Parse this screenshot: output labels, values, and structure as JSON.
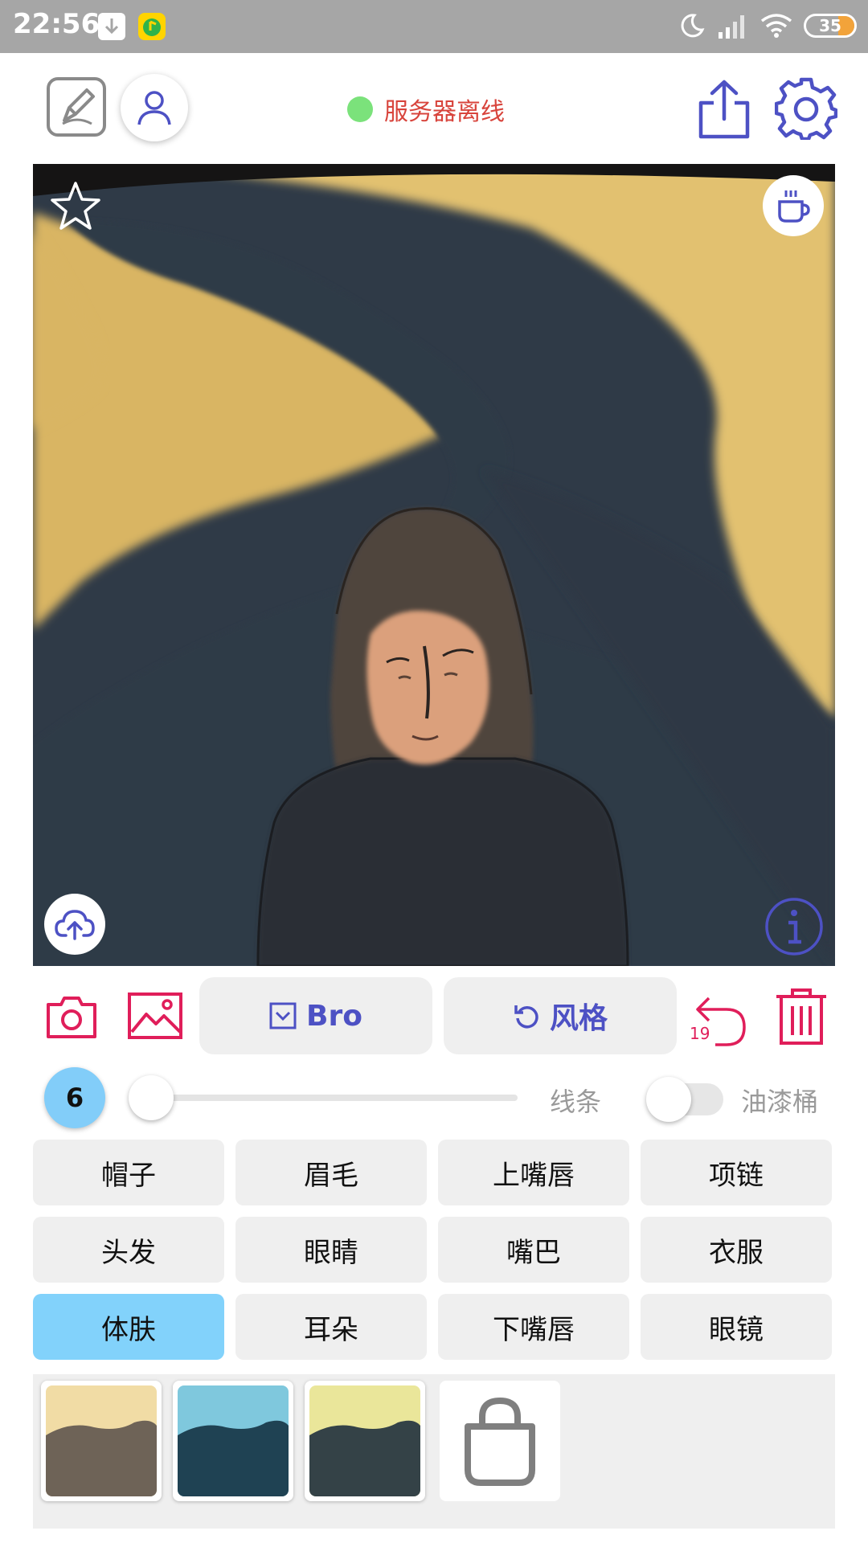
{
  "status_bar": {
    "time": "22:56",
    "battery": "35"
  },
  "header": {
    "server_status": "服务器离线",
    "server_status_color": "#7be27b",
    "status_text_color": "#d8443c"
  },
  "colors": {
    "accent": "#4d51c4",
    "danger": "#e01e5a",
    "selected": "#82d2fb"
  },
  "icons": {
    "edit": "edit-icon",
    "user": "user-icon",
    "share": "share-icon",
    "settings": "gear-icon",
    "favorite": "star-icon",
    "coffee": "coffee-cup-icon",
    "upload": "cloud-upload-icon",
    "info": "info-icon",
    "camera": "camera-icon",
    "gallery": "image-icon",
    "undo": "undo-icon",
    "delete": "trash-icon",
    "shop": "shopping-bag-icon"
  },
  "toolbar": {
    "bro_label": "Bro",
    "style_label": "风格",
    "undo_count": "19"
  },
  "controls": {
    "brush_size": "6",
    "brush_slider_fraction": 0.0,
    "line_label": "线条",
    "paint_bucket_label": "油漆桶",
    "paint_bucket_on": false
  },
  "parts": [
    {
      "label": "帽子",
      "selected": false
    },
    {
      "label": "眉毛",
      "selected": false
    },
    {
      "label": "上嘴唇",
      "selected": false
    },
    {
      "label": "项链",
      "selected": false
    },
    {
      "label": "头发",
      "selected": false
    },
    {
      "label": "眼睛",
      "selected": false
    },
    {
      "label": "嘴巴",
      "selected": false
    },
    {
      "label": "衣服",
      "selected": false
    },
    {
      "label": "体肤",
      "selected": true
    },
    {
      "label": "耳朵",
      "selected": false
    },
    {
      "label": "下嘴唇",
      "selected": false
    },
    {
      "label": "眼镜",
      "selected": false
    }
  ],
  "style_thumbnails": [
    {
      "sky": "#f1dca5",
      "ground": "#6e6357"
    },
    {
      "sky": "#7fc8dd",
      "ground": "#1f4253"
    },
    {
      "sky": "#eae69a",
      "ground": "#344247"
    }
  ]
}
